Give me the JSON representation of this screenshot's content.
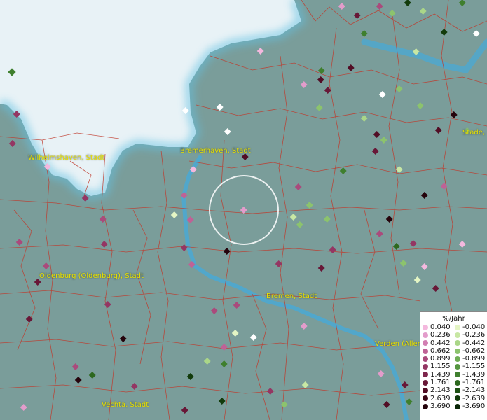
{
  "map": {
    "cities": [
      {
        "name": "Wilhelmshaven, Stadt"
      },
      {
        "name": "Bremerhaven, Stadt"
      },
      {
        "name": "Oldenburg (Oldenburg), Stadt"
      },
      {
        "name": "Bremen, Stadt"
      },
      {
        "name": "Verden (Aller)"
      },
      {
        "name": "Vechta, Stadt"
      },
      {
        "name": "Stade,"
      }
    ],
    "colors": {
      "land": "#7a9d9a",
      "sea": "#e8f2f6",
      "river": "#4aa9d4",
      "borders": "#c0392b",
      "city_label": "#e8e000",
      "selection_circle": "#ffffff"
    }
  },
  "legend": {
    "unit": "%/Jahr",
    "positive": [
      {
        "label": "0.040",
        "color": "#f4b8de"
      },
      {
        "label": "0.236",
        "color": "#e39ccb"
      },
      {
        "label": "0.442",
        "color": "#d27fb2"
      },
      {
        "label": "0.662",
        "color": "#bf6296"
      },
      {
        "label": "0.899",
        "color": "#aa4a7c"
      },
      {
        "label": "1.155",
        "color": "#943663"
      },
      {
        "label": "1.439",
        "color": "#7e254c"
      },
      {
        "label": "1.761",
        "color": "#681737"
      },
      {
        "label": "2.143",
        "color": "#520d25"
      },
      {
        "label": "2.639",
        "color": "#3b0616"
      },
      {
        "label": "3.690",
        "color": "#25030b"
      }
    ],
    "negative": [
      {
        "label": "-0.040",
        "color": "#e4f5c4"
      },
      {
        "label": "-0.236",
        "color": "#c8e7a4"
      },
      {
        "label": "-0.442",
        "color": "#aad688"
      },
      {
        "label": "-0.662",
        "color": "#8cc36d"
      },
      {
        "label": "-0.899",
        "color": "#6fad55"
      },
      {
        "label": "-1.155",
        "color": "#559640"
      },
      {
        "label": "-1.439",
        "color": "#3f7f2e"
      },
      {
        "label": "-1.761",
        "color": "#2d681f"
      },
      {
        "label": "-2.143",
        "color": "#1e5114"
      },
      {
        "label": "-2.639",
        "color": "#123b0b"
      },
      {
        "label": "-3.690",
        "color": "#082505"
      }
    ]
  }
}
